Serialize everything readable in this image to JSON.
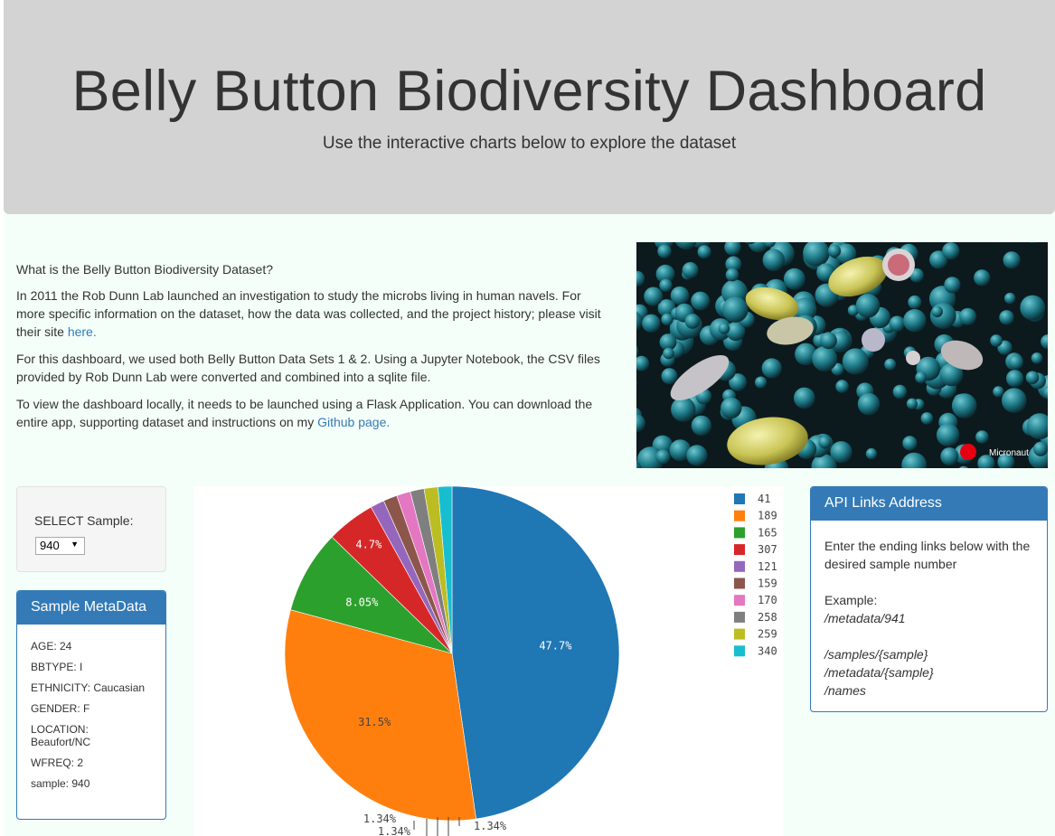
{
  "header": {
    "title": "Belly Button Biodiversity Dashboard",
    "subtitle": "Use the interactive charts below to explore the dataset"
  },
  "intro": {
    "heading": "What is the Belly Button Biodiversity Dataset?",
    "p1_text": "In 2011 the Rob Dunn Lab launched an investigation to study the microbs living in human navels. For more specific information on the dataset, how the data was collected, and the project history; please visit their site ",
    "p1_link": "here.",
    "p2_text": "For this dashboard, we used both Belly Button Data Sets 1 & 2. Using a Jupyter Notebook, the CSV files provided by Rob Dunn Lab were converted and combined into a sqlite file.",
    "p3_text": "To view the dashboard locally, it needs to be launched using a Flask Application. You can download the entire app, supporting dataset and instructions on my ",
    "p3_link": "Github page."
  },
  "image": {
    "watermark": "Micronaut",
    "icon": "microbe-illustration"
  },
  "selector": {
    "label": "SELECT Sample:",
    "value": "940"
  },
  "metadata_panel": {
    "title": "Sample MetaData",
    "rows": [
      "AGE: 24",
      "BBTYPE: I",
      "ETHNICITY: Caucasian",
      "GENDER: F",
      "LOCATION: Beaufort/NC",
      "WFREQ: 2",
      "sample: 940"
    ]
  },
  "api_panel": {
    "title": "API Links Address",
    "instructions": "Enter the ending links below with the desired sample number",
    "example_label": "Example:",
    "example": "/metadata/941",
    "routes": [
      "/samples/{sample}",
      "/metadata/{sample}",
      "/names"
    ]
  },
  "chart_data": {
    "type": "pie",
    "categories": [
      "41",
      "189",
      "165",
      "307",
      "121",
      "159",
      "170",
      "258",
      "259",
      "340"
    ],
    "values": [
      47.7,
      31.5,
      8.05,
      4.7,
      1.34,
      1.34,
      1.34,
      1.34,
      1.34,
      1.34
    ],
    "labels_shown": [
      "47.7%",
      "31.5%",
      "8.05%",
      "4.7%",
      "1.34%",
      "1.34%",
      "1.34%"
    ],
    "colors": [
      "#1f77b4",
      "#ff7f0e",
      "#2ca02c",
      "#d62728",
      "#9467bd",
      "#8c564b",
      "#e377c2",
      "#7f7f7f",
      "#bcbd22",
      "#17becf"
    ],
    "legend_position": "top-right",
    "direction": "clockwise"
  }
}
